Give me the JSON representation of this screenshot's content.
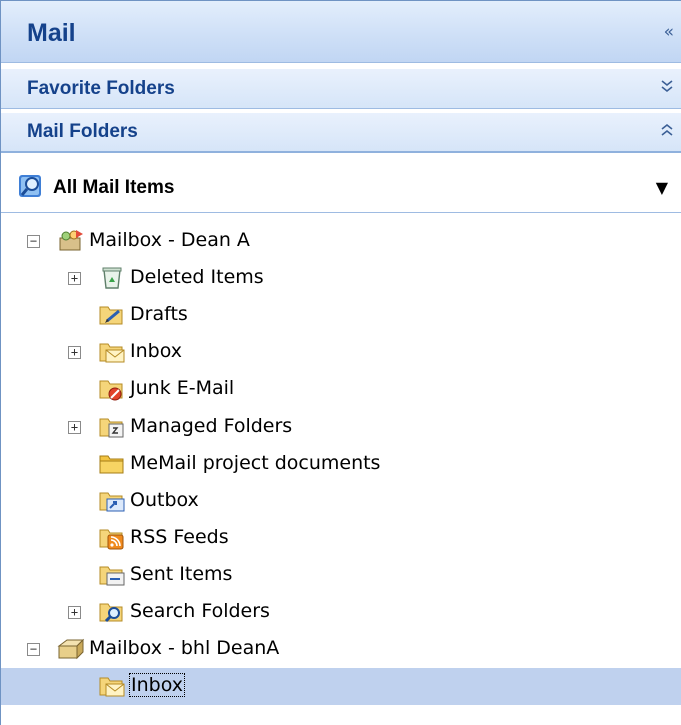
{
  "pane": {
    "title": "Mail",
    "collapse_glyph": "«",
    "sections": {
      "favorite": {
        "label": "Favorite Folders",
        "glyph": "⌄⌄"
      },
      "mail_folders": {
        "label": "Mail Folders",
        "glyph": "⌃⌃"
      }
    },
    "all_items": {
      "label": "All Mail Items",
      "glyph": "▼"
    }
  },
  "tree": [
    {
      "label": "Mailbox - Dean A",
      "level": 0,
      "expander": "−",
      "icon": "mailbox-icon",
      "selected": false
    },
    {
      "label": "Deleted Items",
      "level": 1,
      "expander": "+",
      "icon": "deleted-items-icon",
      "selected": false
    },
    {
      "label": "Drafts",
      "level": 1,
      "expander": "",
      "icon": "drafts-icon",
      "selected": false
    },
    {
      "label": "Inbox",
      "level": 1,
      "expander": "+",
      "icon": "inbox-icon",
      "selected": false
    },
    {
      "label": "Junk E-Mail",
      "level": 1,
      "expander": "",
      "icon": "junk-icon",
      "selected": false
    },
    {
      "label": "Managed Folders",
      "level": 1,
      "expander": "+",
      "icon": "managed-folders-icon",
      "selected": false
    },
    {
      "label": "MeMail project documents",
      "level": 1,
      "expander": "",
      "icon": "folder-icon",
      "selected": false
    },
    {
      "label": "Outbox",
      "level": 1,
      "expander": "",
      "icon": "outbox-icon",
      "selected": false
    },
    {
      "label": "RSS Feeds",
      "level": 1,
      "expander": "",
      "icon": "rss-icon",
      "selected": false
    },
    {
      "label": "Sent Items",
      "level": 1,
      "expander": "",
      "icon": "sent-items-icon",
      "selected": false
    },
    {
      "label": "Search Folders",
      "level": 1,
      "expander": "+",
      "icon": "search-folders-icon",
      "selected": false
    },
    {
      "label": "Mailbox - bhl DeanA",
      "level": 0,
      "expander": "−",
      "icon": "archive-mailbox-icon",
      "selected": false
    },
    {
      "label": "Inbox",
      "level": 1,
      "expander": "",
      "icon": "inbox-icon",
      "selected": true
    }
  ],
  "colors": {
    "header_text": "#15428b",
    "selection": "#bfd1ee",
    "border": "#6f93c3"
  }
}
